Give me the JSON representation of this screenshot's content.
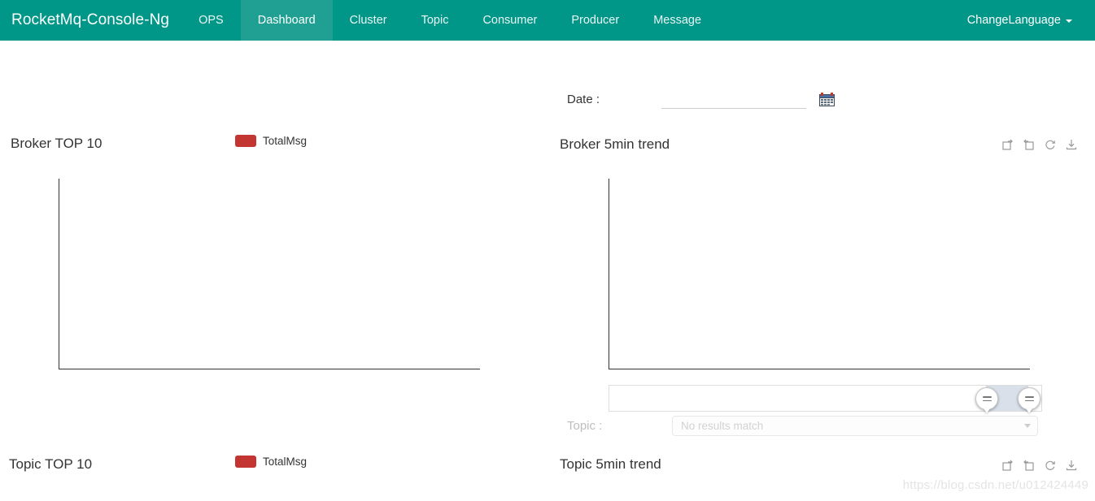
{
  "navbar": {
    "brand": "RocketMq-Console-Ng",
    "items": [
      {
        "label": "OPS",
        "active": false
      },
      {
        "label": "Dashboard",
        "active": true
      },
      {
        "label": "Cluster",
        "active": false
      },
      {
        "label": "Topic",
        "active": false
      },
      {
        "label": "Consumer",
        "active": false
      },
      {
        "label": "Producer",
        "active": false
      },
      {
        "label": "Message",
        "active": false
      }
    ],
    "language_menu": "ChangeLanguage",
    "bg_color": "#009688",
    "active_bg_color": "#1fa093"
  },
  "filters": {
    "date_label": "Date :",
    "date_value": "",
    "date_placeholder": "",
    "topic_label": "Topic :",
    "topic_value": "No results match"
  },
  "toolbox": {
    "data_zoom": "Data Zoom",
    "data_zoom_reset": "Reset Zoom",
    "restore": "Restore",
    "save_image": "Save As Image"
  },
  "panels": {
    "broker_top10": {
      "title": "Broker TOP 10",
      "legend": "TotalMsg",
      "legend_color": "#c23531"
    },
    "broker_trend": {
      "title": "Broker 5min trend"
    },
    "topic_top10": {
      "title": "Topic TOP 10",
      "legend": "TotalMsg",
      "legend_color": "#c23531"
    },
    "topic_trend": {
      "title": "Topic 5min trend"
    }
  },
  "watermark": "https://blog.csdn.net/u012424449",
  "chart_data": [
    {
      "type": "bar",
      "title": "Broker TOP 10",
      "categories": [],
      "series": [
        {
          "name": "TotalMsg",
          "values": [],
          "color": "#c23531"
        }
      ],
      "xlabel": "",
      "ylabel": "",
      "grid": false,
      "legend_position": "top-center",
      "note": "empty chart - axes rendered with no data"
    },
    {
      "type": "line",
      "title": "Broker 5min trend",
      "x": [],
      "series": [],
      "xlabel": "",
      "ylabel": "",
      "grid": false,
      "legend_position": "none",
      "note": "empty chart - axes rendered with no data; dataZoom slider below"
    },
    {
      "type": "bar",
      "title": "Topic TOP 10",
      "categories": [],
      "series": [
        {
          "name": "TotalMsg",
          "values": [],
          "color": "#c23531"
        }
      ],
      "xlabel": "",
      "ylabel": "",
      "grid": false,
      "legend_position": "top-center",
      "note": "empty chart - title row only visible at bottom of viewport"
    },
    {
      "type": "line",
      "title": "Topic 5min trend",
      "x": [],
      "series": [],
      "xlabel": "",
      "ylabel": "",
      "grid": false,
      "legend_position": "none",
      "note": "empty chart - title row only visible at bottom of viewport"
    }
  ]
}
